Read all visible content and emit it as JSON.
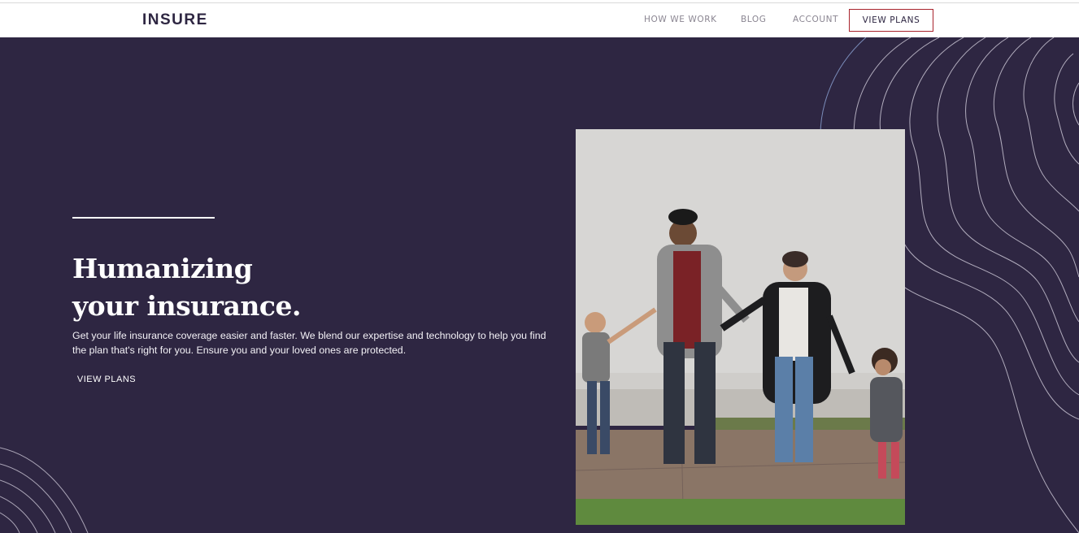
{
  "nav": {
    "logo": "INSURE",
    "links": [
      {
        "label": "HOW WE WORK"
      },
      {
        "label": "BLOG"
      },
      {
        "label": "ACCOUNT"
      }
    ],
    "cta_label": "VIEW PLANS"
  },
  "hero": {
    "headline_line1": "Humanizing",
    "headline_line2": "your insurance.",
    "description": "Get your life insurance coverage easier and faster. We blend our expertise and technology to help you find the plan that's right for you. Ensure you and your loved ones are protected.",
    "cta_label": "VIEW PLANS"
  },
  "colors": {
    "hero_bg": "#2e2642",
    "nav_bg": "#ffffff",
    "accent_border": "#a8232c",
    "nav_link": "#8a8591",
    "logo": "#2e2642"
  }
}
